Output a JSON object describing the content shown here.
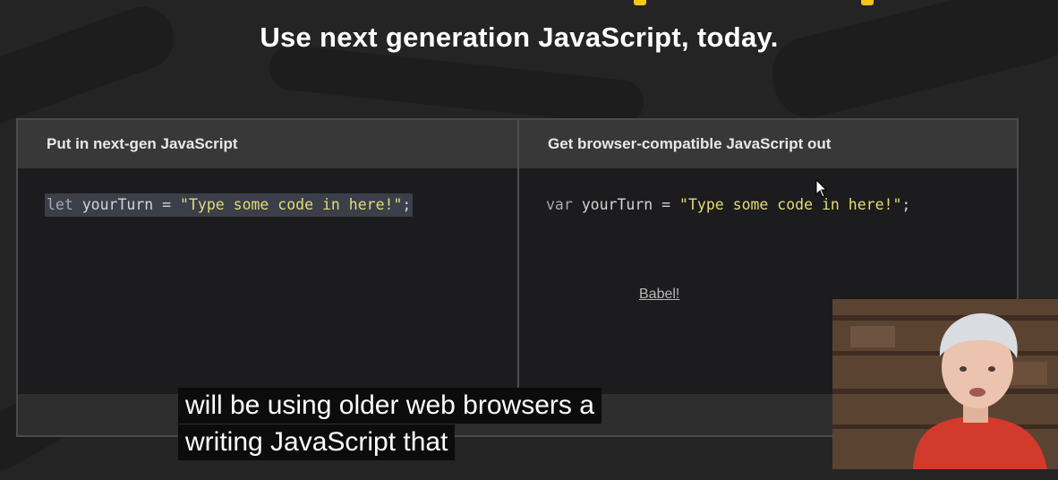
{
  "headline": "Use next generation JavaScript, today.",
  "left_pane": {
    "header": "Put in next-gen JavaScript",
    "code": {
      "keyword": "let",
      "rest": " yourTurn = ",
      "string": "\"Type some code in here!\"",
      "end": ";"
    }
  },
  "right_pane": {
    "header": "Get browser-compatible JavaScript out",
    "code": {
      "keyword": "var",
      "rest": " yourTurn = ",
      "string": "\"Type some code in here!\"",
      "end": ";"
    }
  },
  "footer": {
    "link_text": "Babel!"
  },
  "captions": {
    "line1": "will be using older web browsers a",
    "line2": "writing JavaScript that"
  },
  "colors": {
    "accent": "#f5c518",
    "background": "#242424",
    "editor_bg": "#1c1c1e",
    "string": "#e6db74"
  },
  "icons": {
    "cursor": "mouse-pointer-icon"
  }
}
